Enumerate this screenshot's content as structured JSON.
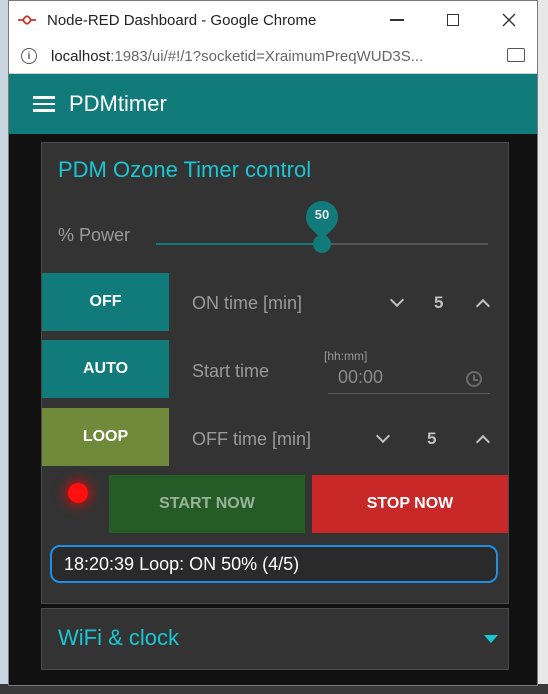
{
  "window": {
    "title": "Node-RED Dashboard - Google Chrome",
    "url_host": "localhost",
    "url_path": ":1983/ui/#!/1?socketid=XraimumPreqWUD3S..."
  },
  "app": {
    "title": "PDMtimer"
  },
  "timer_group": {
    "title": "PDM Ozone Timer control",
    "power": {
      "label": "% Power",
      "value": "50",
      "fraction": 0.5
    },
    "rows": [
      {
        "button": "OFF",
        "button_color": "#117a7a",
        "label": "ON time [min]",
        "value": "5"
      },
      {
        "button": "AUTO",
        "button_color": "#117a7a",
        "label": "Start time",
        "hint": "[hh:mm]",
        "value": "00:00"
      },
      {
        "button": "LOOP",
        "button_color": "#6f8a3a",
        "label": "OFF time [min]",
        "value": "5"
      }
    ],
    "start_button": {
      "label": "START NOW",
      "color": "#255c25"
    },
    "stop_button": {
      "label": "STOP NOW",
      "color": "#c82828"
    },
    "led_color": "#ff1010",
    "status": "18:20:39 Loop: ON 50% (4/5)"
  },
  "wifi_group": {
    "title": "WiFi & clock"
  },
  "colors": {
    "accent": "#117a7a",
    "title_text": "#19c7d4",
    "status_border": "#1e90e8"
  }
}
